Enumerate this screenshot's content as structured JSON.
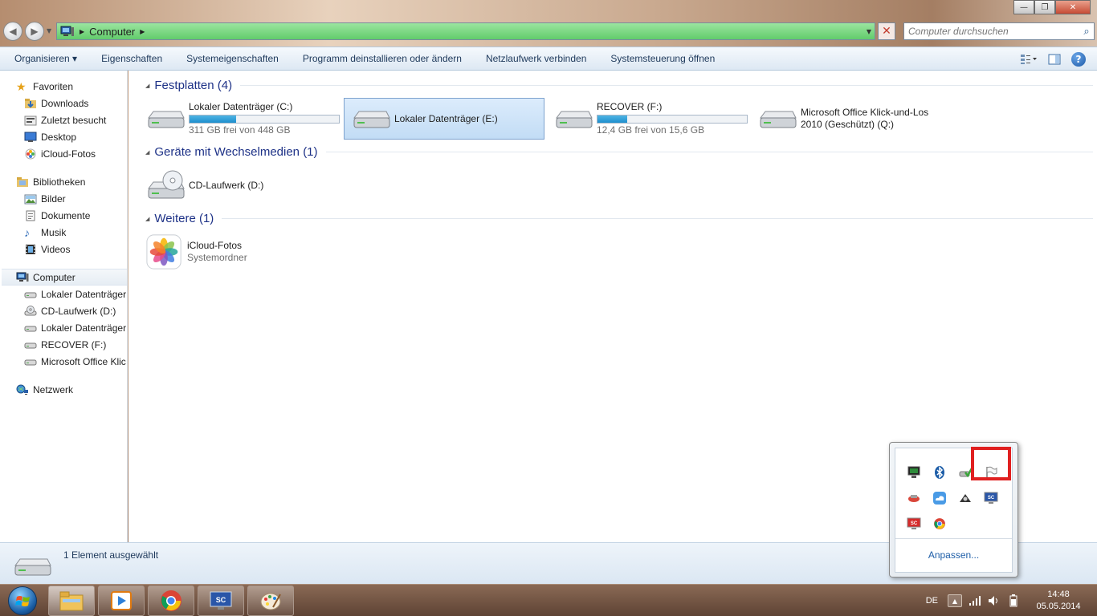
{
  "window": {
    "controls": {
      "minimize": "—",
      "maximize": "❐",
      "close": "✕"
    }
  },
  "addressbar": {
    "crumb": "Computer",
    "crumb_arrow": "▶",
    "drop_arrow": "▼"
  },
  "search": {
    "placeholder": "Computer durchsuchen"
  },
  "toolbar": {
    "organize_label": "Organisieren ▾",
    "items": [
      "Eigenschaften",
      "Systemeigenschaften",
      "Programm deinstallieren oder ändern",
      "Netzlaufwerk verbinden",
      "Systemsteuerung öffnen"
    ]
  },
  "sidebar": {
    "favorites": {
      "label": "Favoriten",
      "items": [
        "Downloads",
        "Zuletzt besucht",
        "Desktop",
        "iCloud-Fotos"
      ]
    },
    "libraries": {
      "label": "Bibliotheken",
      "items": [
        "Bilder",
        "Dokumente",
        "Musik",
        "Videos"
      ]
    },
    "computer": {
      "label": "Computer",
      "items": [
        "Lokaler Datenträger",
        "CD-Laufwerk (D:)",
        "Lokaler Datenträger",
        "RECOVER (F:)",
        "Microsoft Office Klic"
      ]
    },
    "network": {
      "label": "Netzwerk"
    }
  },
  "content": {
    "groups": [
      {
        "label": "Festplatten (4)"
      },
      {
        "label": "Geräte mit Wechselmedien (1)"
      },
      {
        "label": "Weitere (1)"
      }
    ],
    "drives": [
      {
        "name": "Lokaler Datenträger (C:)",
        "free": "311 GB frei von 448 GB",
        "used_fraction": 0.31
      },
      {
        "name": "Lokaler Datenträger (E:)"
      },
      {
        "name": "RECOVER (F:)",
        "free": "12,4 GB frei von 15,6 GB",
        "used_fraction": 0.2
      },
      {
        "name_line1": "Microsoft Office Klick-und-Los",
        "name_line2": "2010 (Geschützt) (Q:)"
      }
    ],
    "removable": [
      {
        "name": "CD-Laufwerk (D:)"
      }
    ],
    "other": [
      {
        "name": "iCloud-Fotos",
        "sub": "Systemordner"
      }
    ]
  },
  "statusbar": {
    "text": "1 Element ausgewählt"
  },
  "taskbar": {
    "lang": "DE",
    "clock_time": "14:48",
    "clock_date": "05.05.2014",
    "tray_up": "▲"
  },
  "tray_popup": {
    "customize_link": "Anpassen..."
  },
  "colors": {
    "selection": "#cce4fb",
    "highlight_box": "#e02020",
    "link": "#1e5ea8",
    "group_header": "#1e3287"
  }
}
